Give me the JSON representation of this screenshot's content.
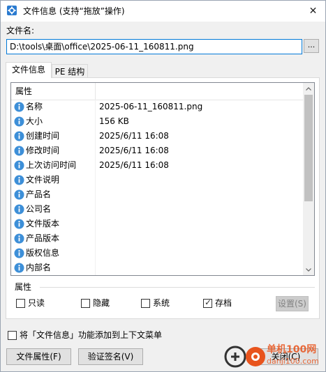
{
  "window": {
    "title": "文件信息 (支持“拖放”操作)",
    "close_glyph": "✕"
  },
  "file": {
    "label": "文件名:",
    "path": "D:\\tools\\桌面\\office\\2025-06-11_160811.png",
    "browse_label": "..."
  },
  "tabs": [
    {
      "label": "文件信息",
      "active": true
    },
    {
      "label": "PE 结构",
      "active": false
    }
  ],
  "properties": {
    "header": "属性",
    "rows": [
      {
        "name": "名称",
        "value": "2025-06-11_160811.png"
      },
      {
        "name": "大小",
        "value": "156 KB"
      },
      {
        "name": "创建时间",
        "value": "2025/6/11 16:08"
      },
      {
        "name": "修改时间",
        "value": "2025/6/11 16:08"
      },
      {
        "name": "上次访问时间",
        "value": "2025/6/11 16:08"
      },
      {
        "name": "文件说明",
        "value": ""
      },
      {
        "name": "产品名",
        "value": ""
      },
      {
        "name": "公司名",
        "value": ""
      },
      {
        "name": "文件版本",
        "value": ""
      },
      {
        "name": "产品版本",
        "value": ""
      },
      {
        "name": "版权信息",
        "value": ""
      },
      {
        "name": "内部名",
        "value": ""
      }
    ]
  },
  "attributes": {
    "title": "属性",
    "items": [
      {
        "label": "只读",
        "checked": false
      },
      {
        "label": "隐藏",
        "checked": false
      },
      {
        "label": "系统",
        "checked": false
      },
      {
        "label": "存档",
        "checked": true
      }
    ],
    "settings_label": "设置(S)"
  },
  "context_menu": {
    "label": "将「文件信息」功能添加到上下文菜单",
    "checked": false
  },
  "buttons": {
    "file_props": "文件属性(F)",
    "verify_sign": "验证签名(V)",
    "close": "关闭(C)"
  },
  "watermark": {
    "line1": "单机100网",
    "line2": "danji100.com"
  },
  "colors": {
    "info_icon": "#3d8fd8",
    "focus_border": "#0078d7",
    "watermark": "#e8541d"
  }
}
